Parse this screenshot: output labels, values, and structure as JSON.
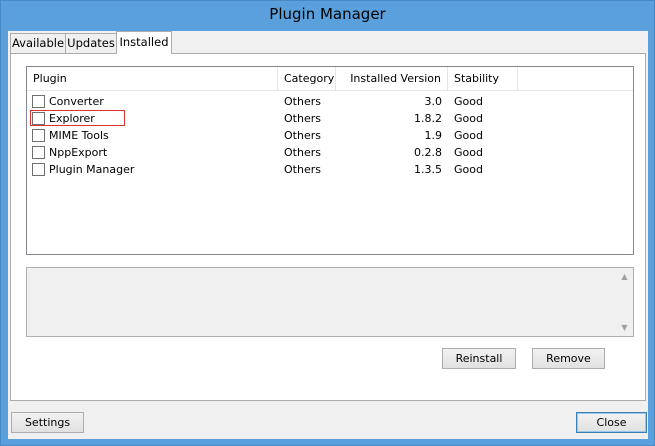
{
  "window": {
    "title": "Plugin Manager"
  },
  "tabs": [
    {
      "label": "Available"
    },
    {
      "label": "Updates"
    },
    {
      "label": "Installed",
      "active": true
    }
  ],
  "table": {
    "columns": [
      "Plugin",
      "Category",
      "Installed Version",
      "Stability"
    ],
    "rows": [
      {
        "plugin": "Converter",
        "category": "Others",
        "version": "3.0",
        "stability": "Good",
        "checked": false
      },
      {
        "plugin": "Explorer",
        "category": "Others",
        "version": "1.8.2",
        "stability": "Good",
        "checked": false,
        "highlighted": true
      },
      {
        "plugin": "MIME Tools",
        "category": "Others",
        "version": "1.9",
        "stability": "Good",
        "checked": false
      },
      {
        "plugin": "NppExport",
        "category": "Others",
        "version": "0.2.8",
        "stability": "Good",
        "checked": false
      },
      {
        "plugin": "Plugin Manager",
        "category": "Others",
        "version": "1.3.5",
        "stability": "Good",
        "checked": false
      }
    ]
  },
  "description": {
    "text": ""
  },
  "buttons": {
    "reinstall": "Reinstall",
    "remove": "Remove",
    "settings": "Settings",
    "close": "Close"
  },
  "icons": {
    "scroll_up": "chevron-up-icon",
    "scroll_down": "chevron-down-icon"
  },
  "colors": {
    "title_bar": "#5aa0dc",
    "highlight_box": "#e03030",
    "default_button_border": "#3c7fb1"
  }
}
